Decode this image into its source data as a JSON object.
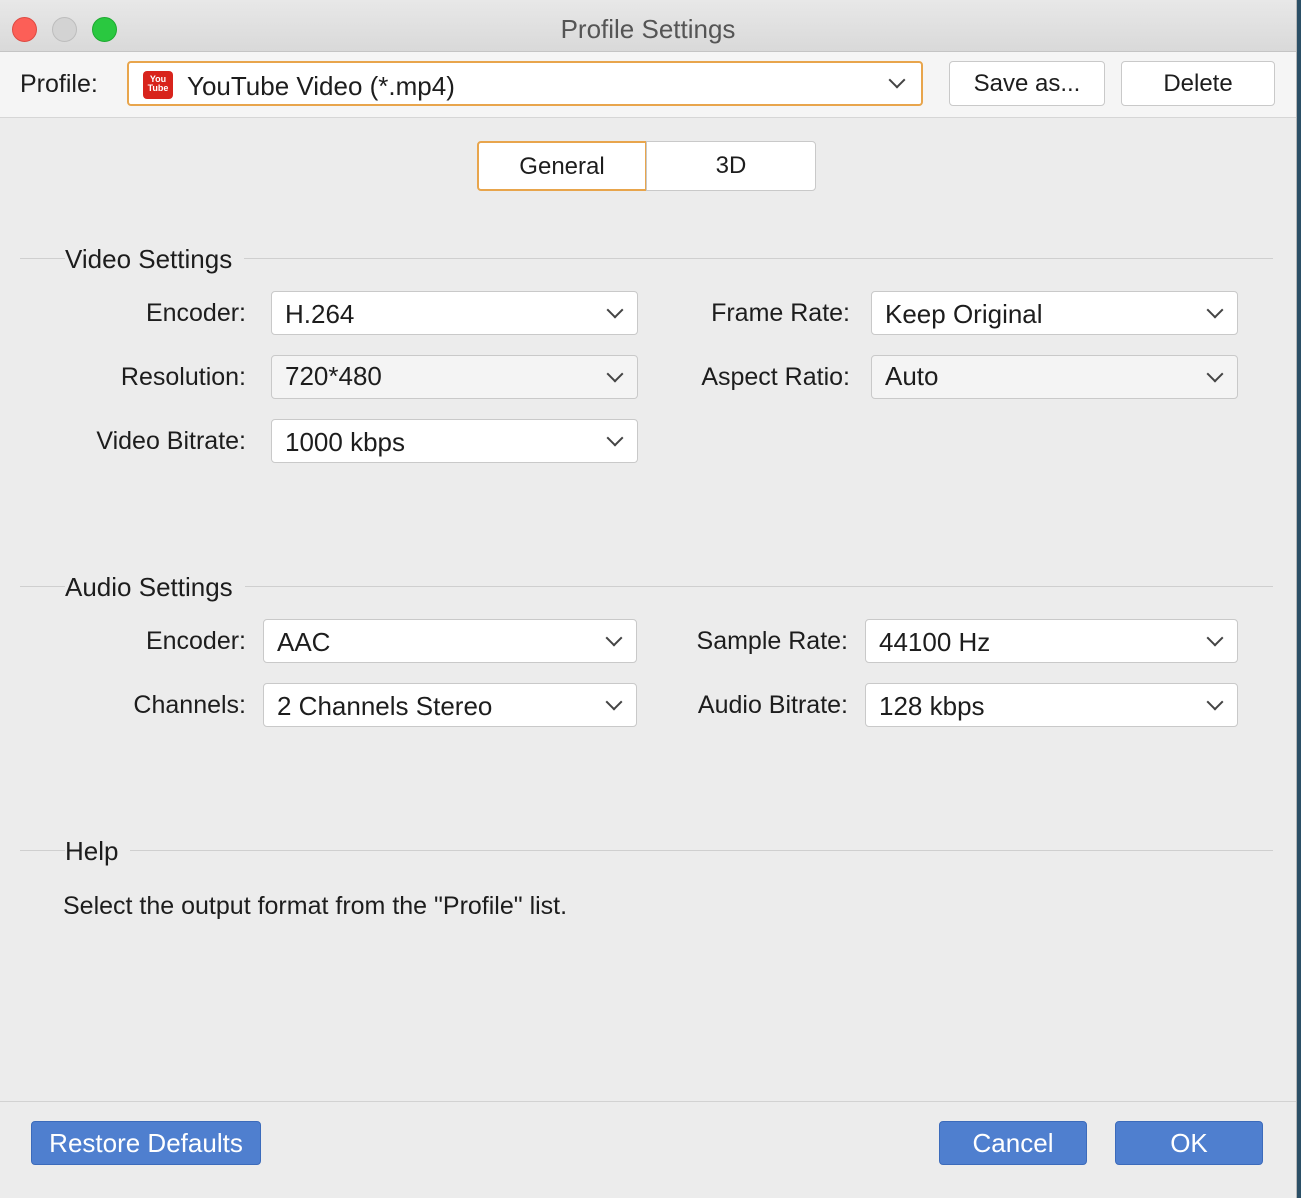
{
  "window": {
    "title": "Profile Settings"
  },
  "toolbar": {
    "profile_label": "Profile:",
    "profile_value": "YouTube Video (*.mp4)",
    "profile_icon_text_1": "You",
    "profile_icon_text_2": "Tube",
    "save_as_label": "Save as...",
    "delete_label": "Delete"
  },
  "tabs": {
    "general": "General",
    "three_d": "3D"
  },
  "video": {
    "title": "Video Settings",
    "encoder_label": "Encoder:",
    "encoder_value": "H.264",
    "resolution_label": "Resolution:",
    "resolution_value": "720*480",
    "bitrate_label": "Video Bitrate:",
    "bitrate_value": "1000 kbps",
    "frame_rate_label": "Frame Rate:",
    "frame_rate_value": "Keep Original",
    "aspect_label": "Aspect Ratio:",
    "aspect_value": "Auto"
  },
  "audio": {
    "title": "Audio Settings",
    "encoder_label": "Encoder:",
    "encoder_value": "AAC",
    "channels_label": "Channels:",
    "channels_value": "2 Channels Stereo",
    "sample_rate_label": "Sample Rate:",
    "sample_rate_value": "44100 Hz",
    "bitrate_label": "Audio Bitrate:",
    "bitrate_value": "128 kbps"
  },
  "help": {
    "title": "Help",
    "text": "Select the output format from the \"Profile\" list."
  },
  "footer": {
    "restore_label": "Restore Defaults",
    "cancel_label": "Cancel",
    "ok_label": "OK"
  },
  "colors": {
    "accent_orange": "#e8a54c",
    "button_blue": "#4f7fcf",
    "close": "#fc5f57",
    "maximize": "#2ac840"
  }
}
